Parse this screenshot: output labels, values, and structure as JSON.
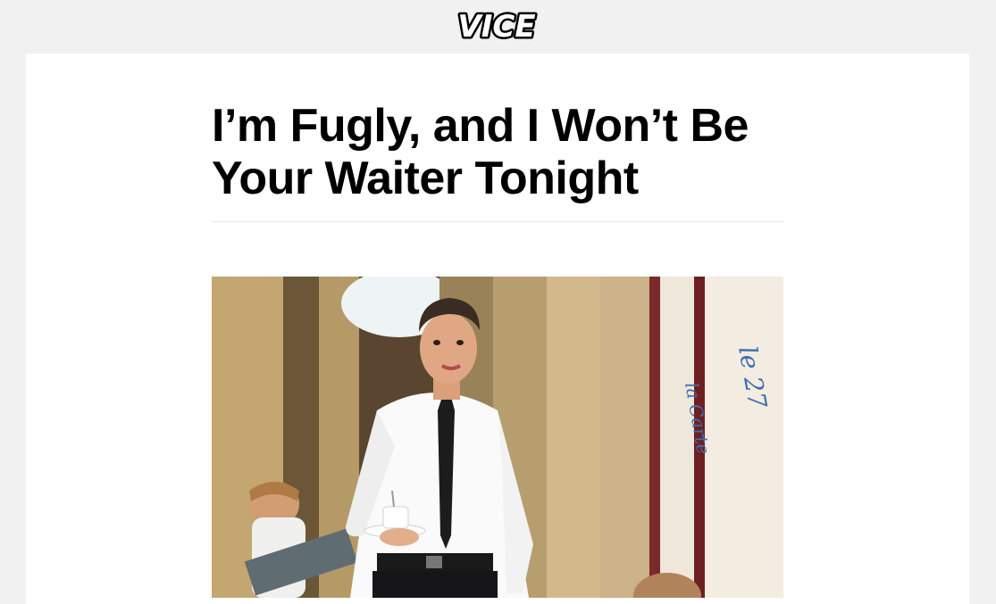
{
  "brand": {
    "logo_text": "VICE"
  },
  "article": {
    "headline": "I’m Fugly, and I Won’t Be Your Waiter Tonight",
    "hero_image": {
      "alt": "Waiter in white shirt and black tie carrying a cup and saucer"
    }
  },
  "colors": {
    "page_bg": "#f1f1f1",
    "card_bg": "#ffffff",
    "text": "#000000",
    "divider": "#e6e6e6"
  }
}
